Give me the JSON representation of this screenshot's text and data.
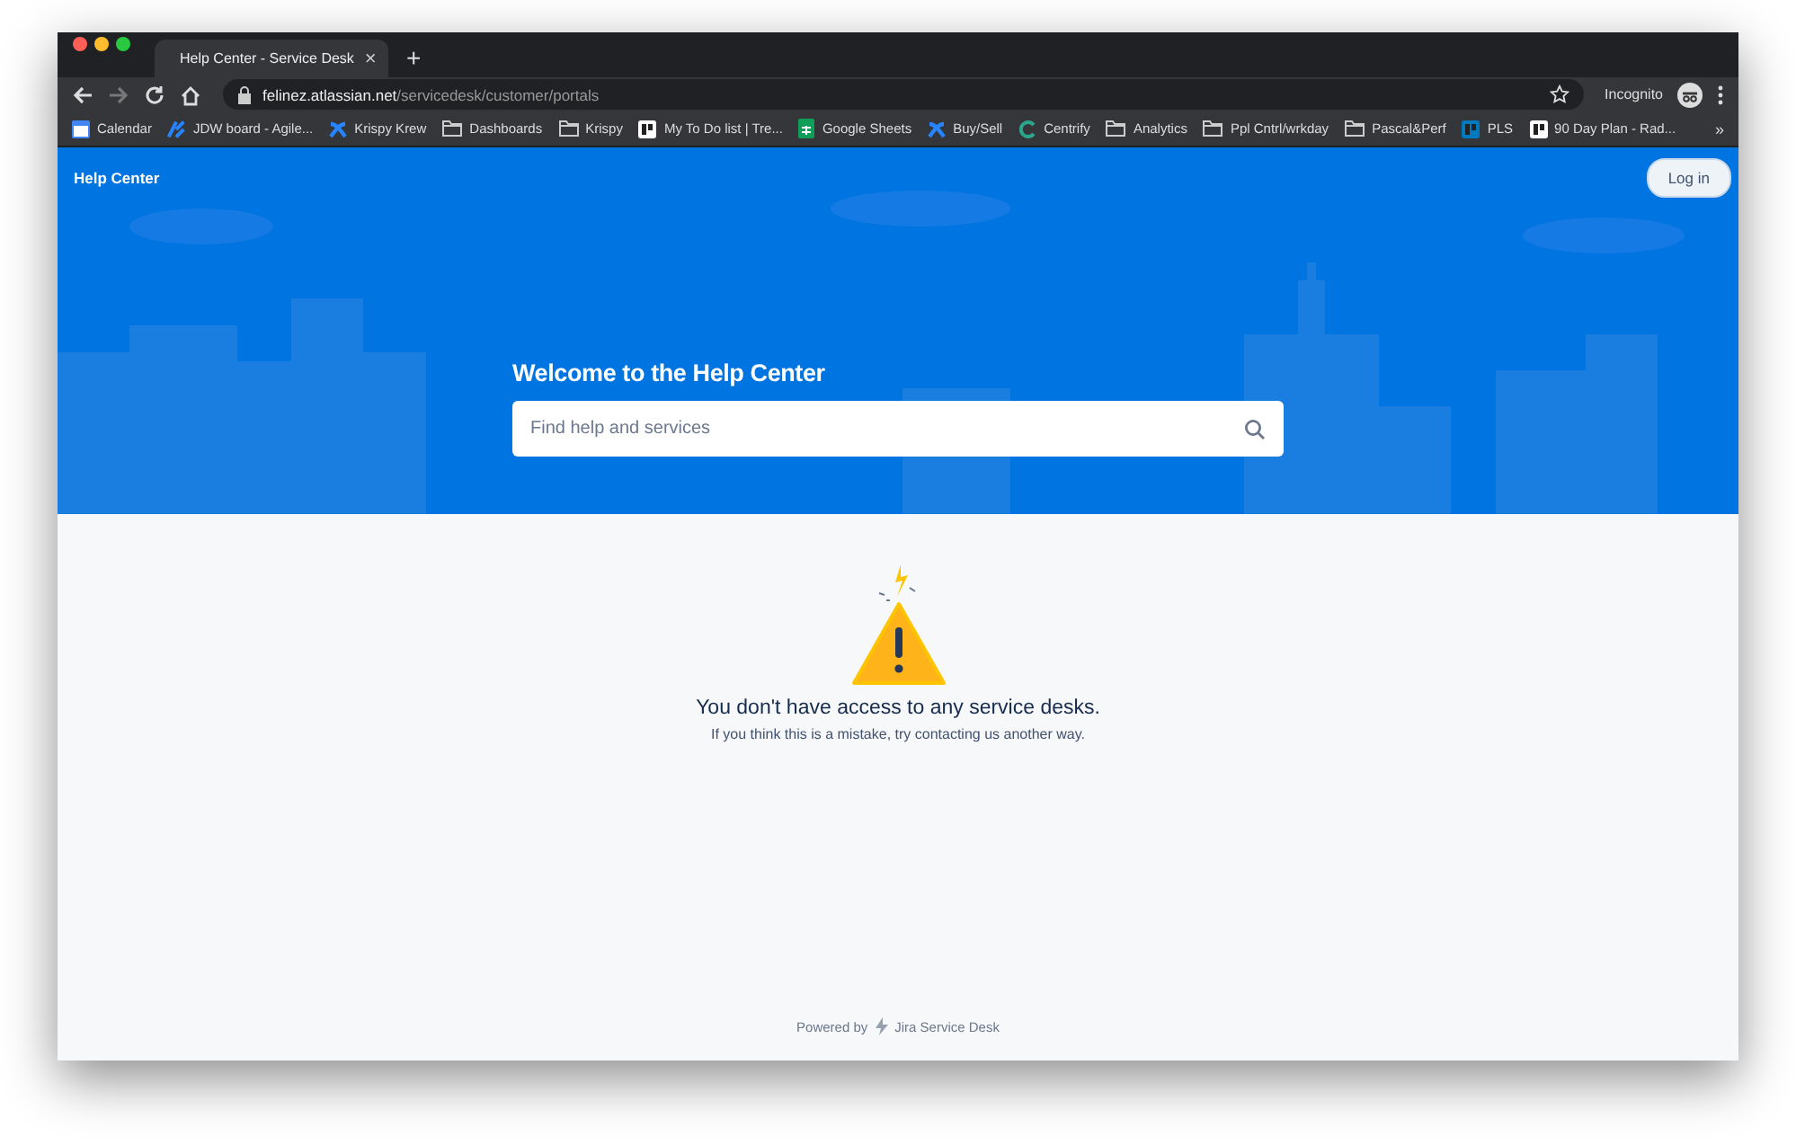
{
  "browser": {
    "tab": {
      "title": "Help Center - Service Desk",
      "close": "×"
    },
    "new_tab": "+",
    "address": {
      "host": "felinez.atlassian.net",
      "path": "/servicedesk/customer/portals"
    },
    "profile": "Incognito",
    "bookmarks": [
      {
        "label": "Calendar",
        "kind": "calendar"
      },
      {
        "label": "JDW board - Agile...",
        "kind": "jira"
      },
      {
        "label": "Krispy Krew",
        "kind": "confluence"
      },
      {
        "label": "Dashboards",
        "kind": "folder"
      },
      {
        "label": "Krispy",
        "kind": "folder"
      },
      {
        "label": "My To Do list | Tre...",
        "kind": "trello"
      },
      {
        "label": "Google Sheets",
        "kind": "sheets"
      },
      {
        "label": "Buy/Sell",
        "kind": "confluence"
      },
      {
        "label": "Centrify",
        "kind": "centrify"
      },
      {
        "label": "Analytics",
        "kind": "folder"
      },
      {
        "label": "Ppl Cntrl/wrkday",
        "kind": "folder"
      },
      {
        "label": "Pascal&Perf",
        "kind": "folder"
      },
      {
        "label": "PLS",
        "kind": "trello"
      },
      {
        "label": "90 Day Plan - Rad...",
        "kind": "trello"
      }
    ],
    "more": "»"
  },
  "header": {
    "brand": "Help Center",
    "login": "Log in",
    "welcome": "Welcome to the Help Center",
    "search": {
      "placeholder": "Find help and services"
    }
  },
  "message": {
    "title": "You don't have access to any service desks.",
    "body": "If you think this is a mistake, try contacting us another way."
  },
  "footer": {
    "powered_by": "Powered by",
    "product": "Jira Service Desk"
  }
}
